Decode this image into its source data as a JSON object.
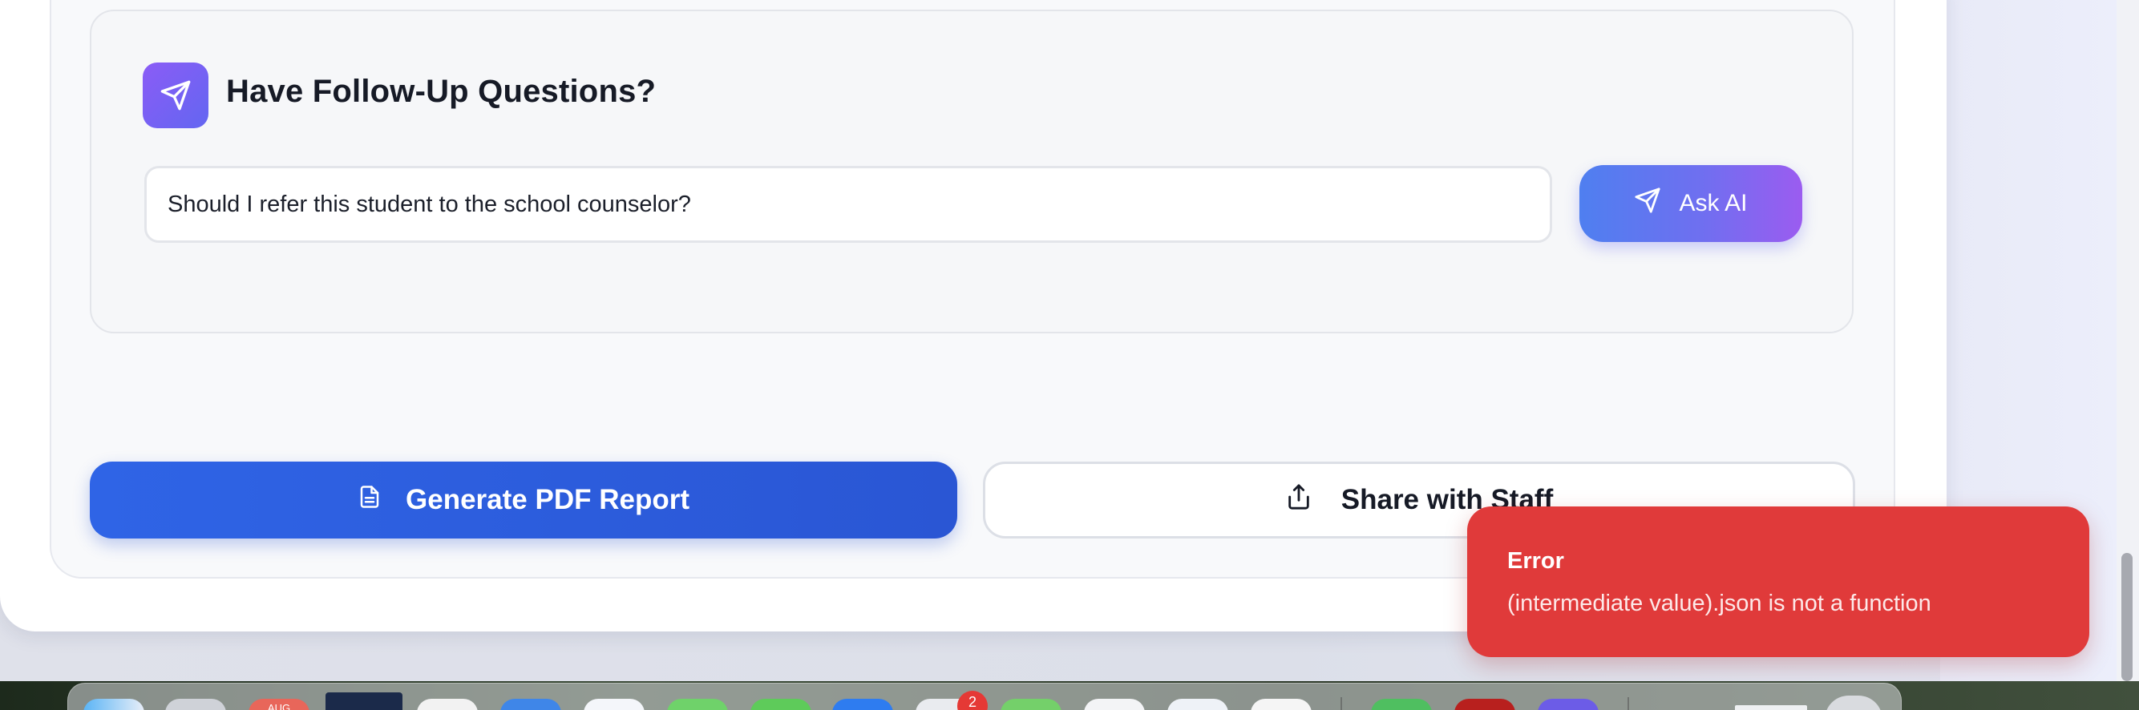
{
  "followup": {
    "title": "Have Follow-Up Questions?",
    "icon": "send-icon",
    "question_value": "Should I refer this student to the school counselor?",
    "ask_label": "Ask AI"
  },
  "actions": {
    "pdf_label": "Generate PDF Report",
    "share_label": "Share with Staff"
  },
  "toast": {
    "title": "Error",
    "message": "(intermediate value).json is not a function",
    "color": "#e03a3a"
  },
  "dock": {
    "calendar_month": "AUG",
    "notification_badge": "2",
    "apps": [
      "finder",
      "launchpad",
      "calendar",
      "photos-wallpaper",
      "notes",
      "mail",
      "chrome",
      "messages",
      "facetime",
      "app-store",
      "activity-monitor",
      "maps",
      "music",
      "safari",
      "reminders",
      "terminal",
      "acrobat",
      "teams"
    ]
  },
  "colors": {
    "primary_blue": "#2f64e6",
    "ask_gradient_start": "#4f7ff0",
    "ask_gradient_end": "#9b5cf0",
    "icon_gradient": "#8b5cf6"
  }
}
